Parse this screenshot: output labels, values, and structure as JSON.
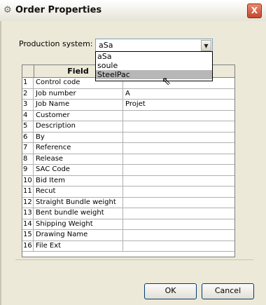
{
  "window": {
    "title": "Order Properties",
    "close_label": "X"
  },
  "production": {
    "label": "Production system:",
    "value": "aSa",
    "options": [
      "aSa",
      "soule",
      "SteelPac"
    ],
    "highlighted": "SteelPac"
  },
  "table": {
    "header_field": "Field",
    "rows": [
      {
        "num": "1",
        "field": "Control code",
        "value": ""
      },
      {
        "num": "2",
        "field": "Job number",
        "value": "A"
      },
      {
        "num": "3",
        "field": "Job Name",
        "value": "Projet"
      },
      {
        "num": "4",
        "field": "Customer",
        "value": ""
      },
      {
        "num": "5",
        "field": "Description",
        "value": ""
      },
      {
        "num": "6",
        "field": "By",
        "value": ""
      },
      {
        "num": "7",
        "field": "Reference",
        "value": ""
      },
      {
        "num": "8",
        "field": "Release",
        "value": ""
      },
      {
        "num": "9",
        "field": "SAC Code",
        "value": ""
      },
      {
        "num": "10",
        "field": "Bid Item",
        "value": ""
      },
      {
        "num": "11",
        "field": "Recut",
        "value": ""
      },
      {
        "num": "12",
        "field": "Straight Bundle weight",
        "value": ""
      },
      {
        "num": "13",
        "field": "Bent bundle weight",
        "value": ""
      },
      {
        "num": "14",
        "field": "Shipping Weight",
        "value": ""
      },
      {
        "num": "15",
        "field": "Drawing Name",
        "value": ""
      },
      {
        "num": "16",
        "field": "File Ext",
        "value": ""
      }
    ]
  },
  "buttons": {
    "ok": "OK",
    "cancel": "Cancel"
  },
  "icons": {
    "title": "gear-icon",
    "close": "close-icon",
    "dropdown": "chevron-down-icon",
    "cursor": "mouse-pointer-icon"
  }
}
